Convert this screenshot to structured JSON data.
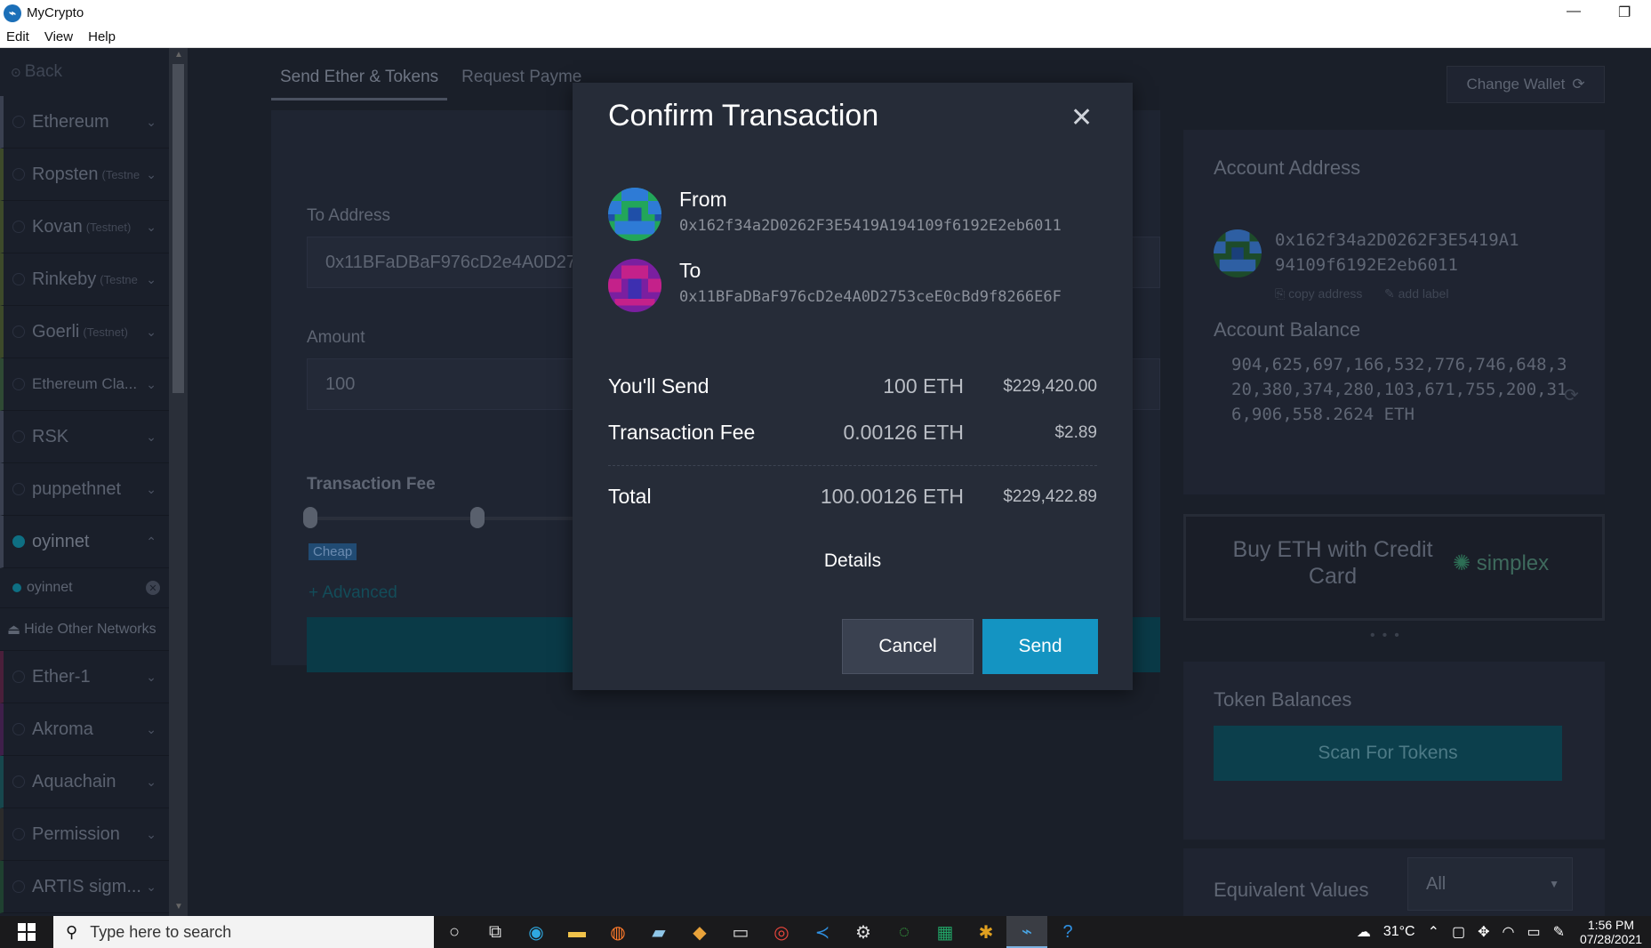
{
  "window": {
    "title": "MyCrypto",
    "minimize": "—",
    "restore": "❐"
  },
  "menu": [
    "Edit",
    "View",
    "Help"
  ],
  "sidebar": {
    "back": "Back",
    "networks": [
      {
        "name": "Ethereum",
        "tag": "",
        "color": "#3a4050"
      },
      {
        "name": "Ropsten",
        "tag": "(Testne",
        "color": "#3d4a2a"
      },
      {
        "name": "Kovan",
        "tag": "(Testnet)",
        "color": "#3d4a2a"
      },
      {
        "name": "Rinkeby",
        "tag": "(Testne",
        "color": "#3d4a2a"
      },
      {
        "name": "Goerli",
        "tag": "(Testnet)",
        "color": "#3d4a2a"
      },
      {
        "name": "Ethereum Cla...",
        "tag": "",
        "color": "#2f4a34"
      },
      {
        "name": "RSK",
        "tag": "",
        "color": "#3a4050"
      },
      {
        "name": "puppethnet",
        "tag": "",
        "color": "#3a4050"
      }
    ],
    "active_network": "oyinnet",
    "active_subnet": "oyinnet",
    "hide_networks": "Hide Other Networks",
    "other_networks": [
      {
        "name": "Ether-1",
        "color": "#4a1f3a"
      },
      {
        "name": "Akroma",
        "color": "#3f1f4a"
      },
      {
        "name": "Aquachain",
        "color": "#17474d"
      },
      {
        "name": "Permission",
        "color": "#2b2b2b"
      },
      {
        "name": "ARTIS sigm...",
        "color": "#1f4030"
      }
    ]
  },
  "main": {
    "tabs": [
      "Send Ether & Tokens",
      "Request Payme"
    ],
    "to_address_label": "To Address",
    "to_address_value": "0x11BFaDBaF976cD2e4A0D27",
    "amount_label": "Amount",
    "amount_value": "100",
    "fee_label": "Transaction Fee",
    "fee_level": "Cheap",
    "advanced": "+ Advanced"
  },
  "right": {
    "change_wallet": "Change Wallet",
    "account_address_title": "Account Address",
    "account_address_line1": "0x162f34a2D0262F3E5419A1",
    "account_address_line2": "94109f6192E2eb6011",
    "copy_address": "copy address",
    "add_label": "add label",
    "account_balance_title": "Account Balance",
    "account_balance_value": "904,625,697,166,532,776,746,648,320,380,374,280,103,671,755,200,316,906,558.2624 ETH",
    "buy_text": "Buy ETH with Credit Card",
    "simplex": "simplex",
    "token_balances_title": "Token Balances",
    "scan_tokens": "Scan For Tokens",
    "equivalent_values_title": "Equivalent Values",
    "equivalent_select": "All"
  },
  "modal": {
    "title": "Confirm Transaction",
    "from_label": "From",
    "from_address": "0x162f34a2D0262F3E5419A194109f6192E2eb6011",
    "to_label": "To",
    "to_address": "0x11BFaDBaF976cD2e4A0D2753ceE0cBd9f8266E6F",
    "rows": [
      {
        "label": "You'll Send",
        "eth": "100 ETH",
        "usd": "$229,420.00"
      },
      {
        "label": "Transaction Fee",
        "eth": "0.00126 ETH",
        "usd": "$2.89"
      },
      {
        "label": "Total",
        "eth": "100.00126 ETH",
        "usd": "$229,422.89"
      }
    ],
    "details": "Details",
    "cancel": "Cancel",
    "send": "Send"
  },
  "taskbar": {
    "search_placeholder": "Type here to search",
    "weather": "31°C",
    "time": "1:56 PM",
    "date": "07/28/2021"
  },
  "colors": {
    "accent": "#1494c2",
    "modal_bg": "#262c38",
    "app_bg": "#1d2330"
  }
}
